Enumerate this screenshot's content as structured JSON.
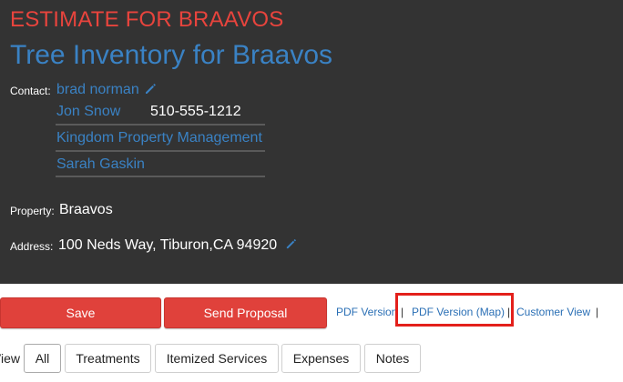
{
  "header": {
    "estimate_title": "ESTIMATE FOR BRAAVOS",
    "inventory_title": "Tree Inventory for Braavos",
    "contact_label": "Contact:",
    "contact_name": "brad norman",
    "contacts": [
      {
        "name": "Jon Snow",
        "phone": "510-555-1212"
      },
      {
        "name": "Kingdom Property Management"
      },
      {
        "name": "Sarah Gaskin"
      }
    ],
    "property_label": "Property:",
    "property_value": "Braavos",
    "address_label": "Address:",
    "address_value": "100 Neds Way, Tiburon,CA 94920"
  },
  "actions": {
    "save_label": "Save",
    "send_proposal_label": "Send Proposal",
    "pdf_version": "PDF Version",
    "pdf_version_map": "PDF Version (Map)",
    "customer_view": "Customer View",
    "separator": "|"
  },
  "view": {
    "label": "View",
    "tabs": [
      "All",
      "Treatments",
      "Itemized Services",
      "Expenses",
      "Notes"
    ]
  },
  "colors": {
    "header_bg": "#333333",
    "accent_red": "#e0413b",
    "link_blue": "#3a82c4",
    "highlight_red": "#e3201b"
  }
}
